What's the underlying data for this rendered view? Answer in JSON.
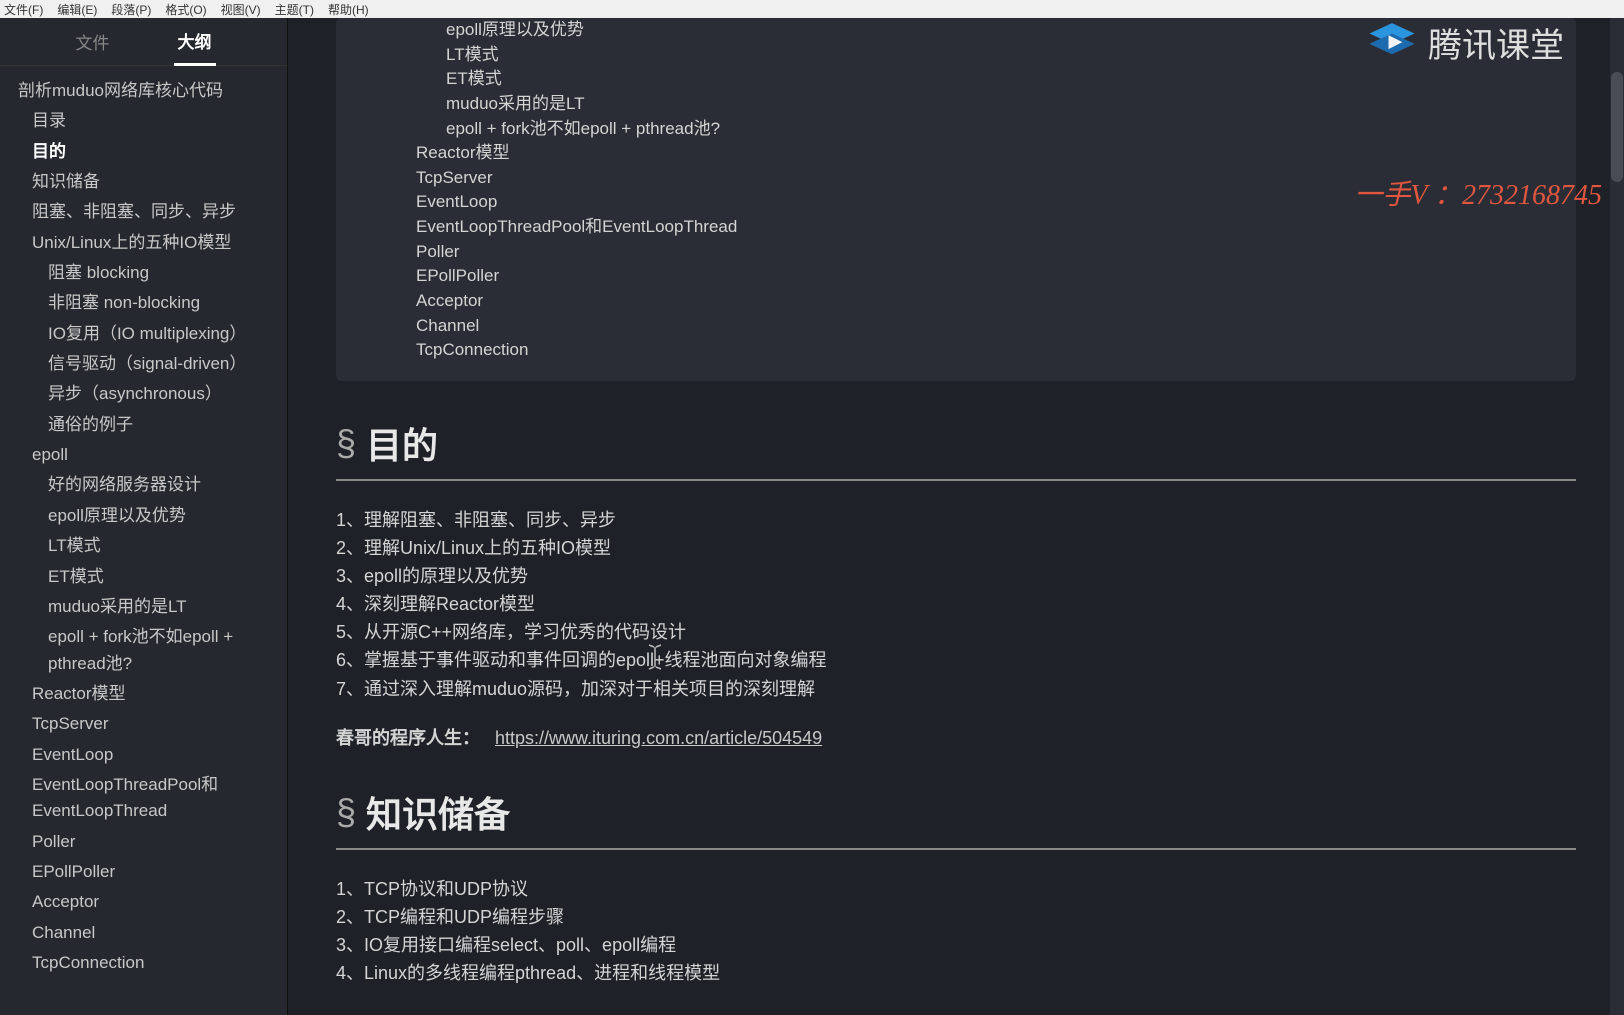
{
  "menubar": {
    "items": [
      "文件(F)",
      "编辑(E)",
      "段落(P)",
      "格式(O)",
      "视图(V)",
      "主题(T)",
      "帮助(H)"
    ]
  },
  "sidebar": {
    "tabs": {
      "file": "文件",
      "outline": "大纲"
    },
    "active_tab": "outline",
    "outline": [
      {
        "label": "剖析muduo网络库核心代码",
        "level": 0
      },
      {
        "label": "目录",
        "level": 1
      },
      {
        "label": "目的",
        "level": 1,
        "active": true
      },
      {
        "label": "知识储备",
        "level": 1
      },
      {
        "label": "阻塞、非阻塞、同步、异步",
        "level": 1
      },
      {
        "label": "Unix/Linux上的五种IO模型",
        "level": 1
      },
      {
        "label": "阻塞 blocking",
        "level": 2
      },
      {
        "label": "非阻塞 non-blocking",
        "level": 2
      },
      {
        "label": "IO复用（IO multiplexing）",
        "level": 2
      },
      {
        "label": "信号驱动（signal-driven）",
        "level": 2
      },
      {
        "label": "异步（asynchronous）",
        "level": 2
      },
      {
        "label": "通俗的例子",
        "level": 2
      },
      {
        "label": "epoll",
        "level": 1
      },
      {
        "label": "好的网络服务器设计",
        "level": 2
      },
      {
        "label": "epoll原理以及优势",
        "level": 2
      },
      {
        "label": "LT模式",
        "level": 2
      },
      {
        "label": "ET模式",
        "level": 2
      },
      {
        "label": "muduo采用的是LT",
        "level": 2
      },
      {
        "label": "epoll + fork池不如epoll + pthread池?",
        "level": 2
      },
      {
        "label": "Reactor模型",
        "level": 1
      },
      {
        "label": "TcpServer",
        "level": 1
      },
      {
        "label": "EventLoop",
        "level": 1
      },
      {
        "label": "EventLoopThreadPool和EventLoopThread",
        "level": 1
      },
      {
        "label": "Poller",
        "level": 1
      },
      {
        "label": "EPollPoller",
        "level": 1
      },
      {
        "label": "Acceptor",
        "level": 1
      },
      {
        "label": "Channel",
        "level": 1
      },
      {
        "label": "TcpConnection",
        "level": 1
      }
    ]
  },
  "main": {
    "toc_block": [
      {
        "text": "epoll原理以及优势",
        "indent": 3
      },
      {
        "text": "LT模式",
        "indent": 3
      },
      {
        "text": "ET模式",
        "indent": 3
      },
      {
        "text": "muduo采用的是LT",
        "indent": 3
      },
      {
        "text": "epoll + fork池不如epoll + pthread池?",
        "indent": 3
      },
      {
        "text": "Reactor模型",
        "indent": 2
      },
      {
        "text": "TcpServer",
        "indent": 2
      },
      {
        "text": "EventLoop",
        "indent": 2
      },
      {
        "text": "EventLoopThreadPool和EventLoopThread",
        "indent": 2
      },
      {
        "text": "Poller",
        "indent": 2
      },
      {
        "text": "EPollPoller",
        "indent": 2
      },
      {
        "text": "Acceptor",
        "indent": 2
      },
      {
        "text": "Channel",
        "indent": 2
      },
      {
        "text": "TcpConnection",
        "indent": 2
      }
    ],
    "section1": {
      "symbol": "§",
      "title": "目的",
      "items": [
        "1、理解阻塞、非阻塞、同步、异步",
        "2、理解Unix/Linux上的五种IO模型",
        "3、epoll的原理以及优势",
        "4、深刻理解Reactor模型",
        "5、从开源C++网络库，学习优秀的代码设计",
        "6、掌握基于事件驱动和事件回调的epoll+线程池面向对象编程",
        "7、通过深入理解muduo源码，加深对于相关项目的深刻理解"
      ],
      "link_label": "春哥的程序人生：",
      "link_url": "https://www.ituring.com.cn/article/504549"
    },
    "section2": {
      "symbol": "§",
      "title": "知识储备",
      "items": [
        "1、TCP协议和UDP协议",
        "2、TCP编程和UDP编程步骤",
        "3、IO复用接口编程select、poll、epoll编程",
        "4、Linux的多线程编程pthread、进程和线程模型"
      ]
    }
  },
  "watermark": {
    "brand": "腾讯课堂",
    "contact": "一手V ：2732168745"
  }
}
